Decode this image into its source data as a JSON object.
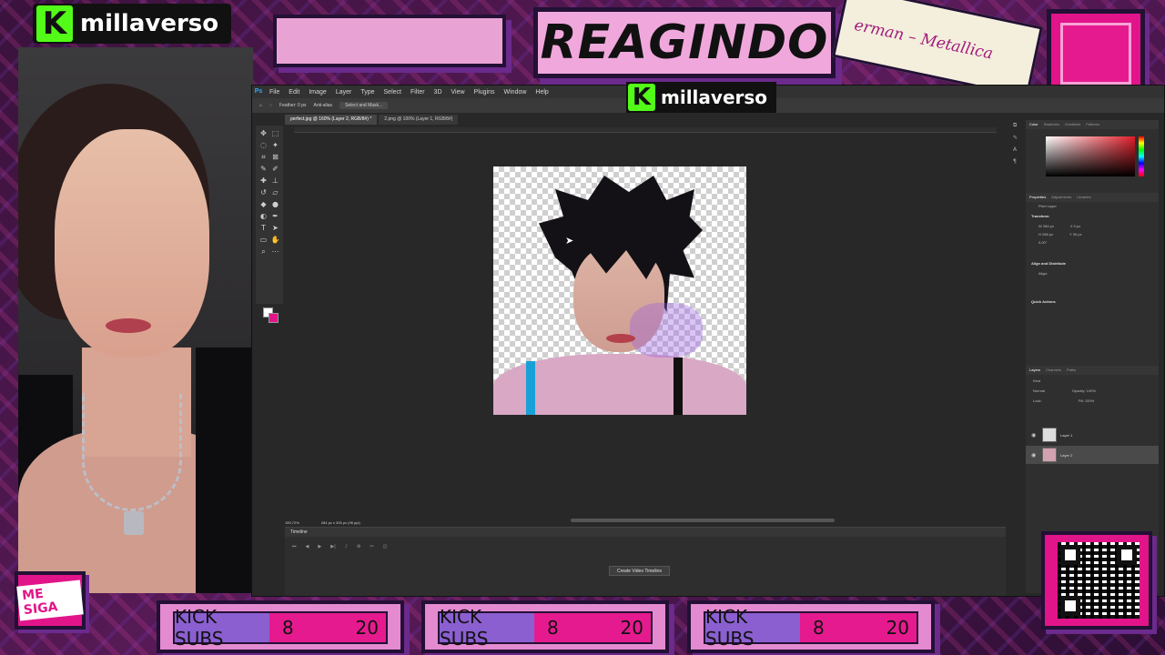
{
  "overlay": {
    "channel_name": "millaverso",
    "title": "REAGINDO",
    "song_tag": "erman – Metallica",
    "follow_button": "ME SIGA",
    "sub_bars": [
      {
        "label": "KICK SUBS",
        "current": "8",
        "goal": "20"
      },
      {
        "label": "KICK SUBS",
        "current": "8",
        "goal": "20"
      },
      {
        "label": "KICK SUBS",
        "current": "8",
        "goal": "20"
      }
    ],
    "colors": {
      "accent": "#e2148a",
      "brand_green": "#53fc18",
      "frame": "#231035",
      "purple": "#8b5fd0"
    }
  },
  "photoshop": {
    "menu": [
      "File",
      "Edit",
      "Image",
      "Layer",
      "Type",
      "Select",
      "Filter",
      "3D",
      "View",
      "Plugins",
      "Window",
      "Help"
    ],
    "options_bar": {
      "feather": "Feather: 0 px",
      "anti_alias": "Anti-alias",
      "select_mask": "Select and Mask..."
    },
    "tabs": [
      {
        "label": "perfect.jpg @ 160% (Layer 2, RGB/8#) *",
        "active": true
      },
      {
        "label": "2.png @ 100% (Layer 1, RGB/8#)",
        "active": false
      }
    ],
    "status": {
      "zoom": "159,72%",
      "doc_size": "284 px x 326 px (96 ppi)"
    },
    "timeline": {
      "title": "Timeline",
      "create_button": "Create Video Timeline"
    },
    "right_panel": {
      "color_tabs": [
        "Color",
        "Swatches",
        "Gradients",
        "Patterns"
      ],
      "property_tabs": [
        "Properties",
        "Adjustments",
        "Libraries"
      ],
      "pixel_layer": "Pixel Layer",
      "transform_title": "Transform",
      "w": "W 284 px",
      "x": "X 0 px",
      "h": "H 288 px",
      "y": "Y 30 px",
      "angle": "0,00°",
      "align_title": "Align and Distribute",
      "align_sub": "Align:",
      "quick_actions": "Quick Actions",
      "layer_tabs": [
        "Layers",
        "Channels",
        "Paths"
      ],
      "kind": "Kind",
      "blend_mode": "Normal",
      "opacity": "Opacity: 100%",
      "lock": "Lock:",
      "fill": "Fill: 100%",
      "layers": [
        "Layer 1",
        "Layer 2"
      ]
    }
  }
}
